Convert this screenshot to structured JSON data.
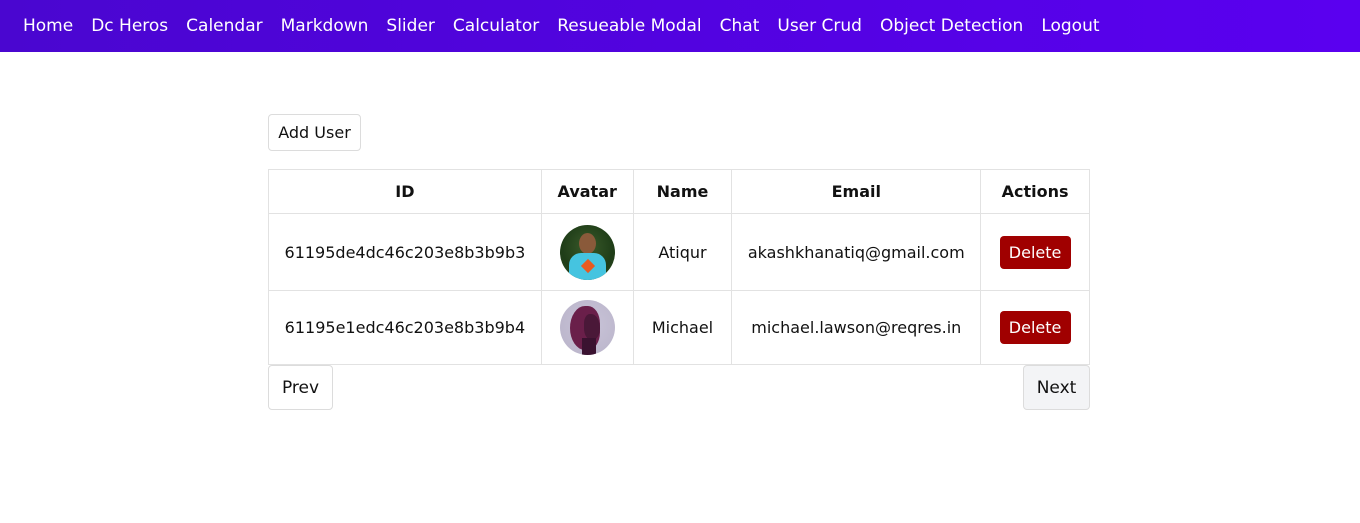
{
  "nav": {
    "items": [
      "Home",
      "Dc Heros",
      "Calendar",
      "Markdown",
      "Slider",
      "Calculator",
      "Resueable Modal",
      "Chat",
      "User Crud",
      "Object Detection",
      "Logout"
    ],
    "gradient_start": "#4a06d0",
    "gradient_end": "#5a00f0"
  },
  "toolbar": {
    "add_user_label": "Add User"
  },
  "table": {
    "headers": {
      "id": "ID",
      "avatar": "Avatar",
      "name": "Name",
      "email": "Email",
      "actions": "Actions"
    },
    "rows": [
      {
        "id": "61195de4dc46c203e8b3b9b3",
        "avatar_icon": "user-photo-avatar",
        "name": "Atiqur",
        "email": "akashkhanatiq@gmail.com",
        "action_label": "Delete"
      },
      {
        "id": "61195e1edc46c203e8b3b9b4",
        "avatar_icon": "user-photo-avatar",
        "name": "Michael",
        "email": "michael.lawson@reqres.in",
        "action_label": "Delete"
      }
    ]
  },
  "pagination": {
    "prev_label": "Prev",
    "next_label": "Next"
  },
  "colors": {
    "delete_button": "#a00000"
  }
}
